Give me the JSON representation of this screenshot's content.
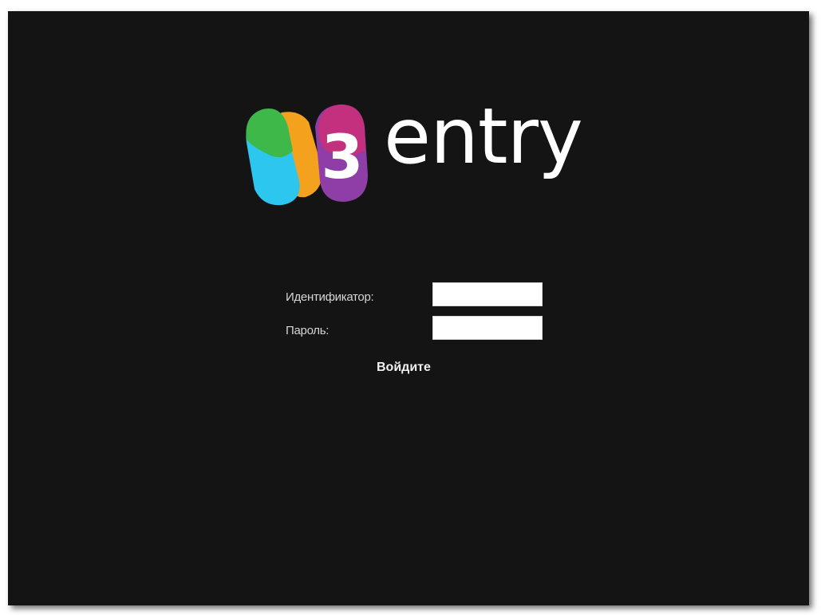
{
  "logo": {
    "badge_digit": "3",
    "wordmark": "entry",
    "colors": {
      "green": "#3fb84a",
      "cyan": "#2cc6ef",
      "orange": "#f4a21d",
      "magenta": "#c2307e",
      "purple": "#8e3ea6"
    }
  },
  "login": {
    "id_label": "Идентификатор:",
    "id_value": "",
    "password_label": "Пароль:",
    "password_value": "",
    "submit_label": "Войдите"
  },
  "theme": {
    "background": "#141414",
    "text": "#d6d6d6"
  }
}
